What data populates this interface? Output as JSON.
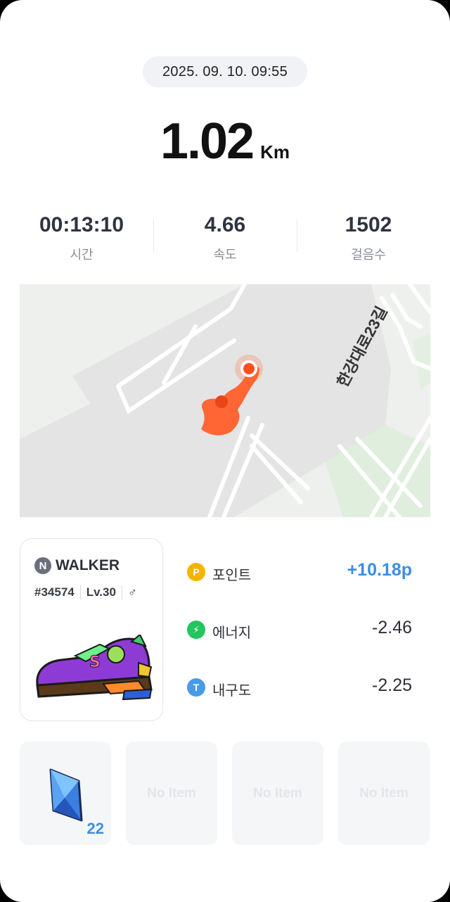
{
  "session": {
    "datetime": "2025. 09. 10. 09:55",
    "distance_value": "1.02",
    "distance_unit": "Km"
  },
  "stats": [
    {
      "value": "00:13:10",
      "label": "시간"
    },
    {
      "value": "4.66",
      "label": "속도"
    },
    {
      "value": "1502",
      "label": "걸음수"
    }
  ],
  "map": {
    "road_label": "한강대로23길",
    "route_color": "#ff6633"
  },
  "nft": {
    "badge_letter": "N",
    "brand": "WALKER",
    "id": "#34574",
    "level": "Lv.30",
    "gender_symbol": "♂"
  },
  "rewards": [
    {
      "icon": "point-icon",
      "icon_letter": "P",
      "label": "포인트",
      "amount": "+10.18p",
      "color": "#f5b400"
    },
    {
      "icon": "energy-icon",
      "icon_letter": "⚡",
      "label": "에너지",
      "amount": "-2.46",
      "color": "#22c55e"
    },
    {
      "icon": "durability-icon",
      "icon_letter": "T",
      "label": "내구도",
      "amount": "-2.25",
      "color": "#4a9ae8"
    }
  ],
  "items": [
    {
      "type": "gem",
      "count": "22"
    },
    {
      "empty_label": "No Item"
    },
    {
      "empty_label": "No Item"
    },
    {
      "empty_label": "No Item"
    }
  ]
}
